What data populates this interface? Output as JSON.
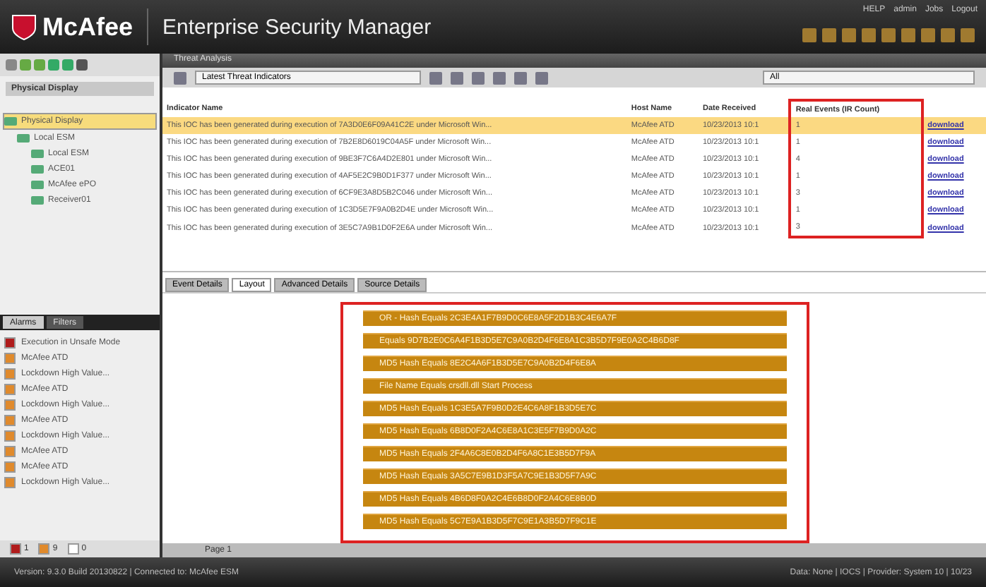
{
  "header": {
    "brand": "McAfee",
    "title": "Enterprise Security Manager",
    "links": [
      "HELP",
      "admin",
      "Jobs",
      "Logout"
    ]
  },
  "sidebar": {
    "view_title": "Physical Display",
    "tree": [
      {
        "label": "Physical Display",
        "selected": true,
        "children": [
          {
            "label": "Local ESM",
            "selected": false,
            "children": [
              {
                "label": "Local ESM",
                "selected": false
              },
              {
                "label": "ACE01",
                "selected": false
              },
              {
                "label": "McAfee ePO",
                "selected": false
              },
              {
                "label": "Receiver01",
                "selected": false
              }
            ]
          }
        ]
      }
    ],
    "tabs": [
      {
        "label": "Alarms",
        "selected": true
      },
      {
        "label": "Filters",
        "selected": false
      }
    ],
    "alarms": [
      {
        "label": "Execution in Unsafe Mode",
        "color": "#b01c1c"
      },
      {
        "label": "McAfee ATD",
        "color": "#e08a2c"
      },
      {
        "label": "Lockdown High Value...",
        "color": "#e08a2c"
      },
      {
        "label": "McAfee ATD",
        "color": "#e08a2c"
      },
      {
        "label": "Lockdown High Value...",
        "color": "#e08a2c"
      },
      {
        "label": "McAfee ATD",
        "color": "#e08a2c"
      },
      {
        "label": "Lockdown High Value...",
        "color": "#e08a2c"
      },
      {
        "label": "McAfee ATD",
        "color": "#e08a2c"
      },
      {
        "label": "McAfee ATD",
        "color": "#e08a2c"
      },
      {
        "label": "Lockdown High Value...",
        "color": "#e08a2c"
      }
    ],
    "severity_counts": [
      {
        "count": "1",
        "color": "#b01c1c"
      },
      {
        "count": "9",
        "color": "#e08a2c"
      },
      {
        "count": "0",
        "color": "#ffffff"
      }
    ]
  },
  "main": {
    "panel_title": "Threat Analysis",
    "view_select": "Latest Threat Indicators",
    "filter_select": "All",
    "table": {
      "columns": [
        "Indicator Name",
        "Host Name",
        "Date Received",
        "Real Events (IR Count)",
        ""
      ],
      "rows": [
        {
          "name": "This IOC has been generated during execution of 7A3D0E6F09A41C2E under Microsoft Win...",
          "host": "McAfee ATD",
          "date": "10/23/2013 10:1",
          "count": "1",
          "action": "download",
          "selected": true
        },
        {
          "name": "This IOC has been generated during execution of 7B2E8D6019C04A5F under Microsoft Win...",
          "host": "McAfee ATD",
          "date": "10/23/2013 10:1",
          "count": "1",
          "action": "download",
          "selected": false
        },
        {
          "name": "This IOC has been generated during execution of 9BE3F7C6A4D2E801 under Microsoft Win...",
          "host": "McAfee ATD",
          "date": "10/23/2013 10:1",
          "count": "4",
          "action": "download",
          "selected": false
        },
        {
          "name": "This IOC has been generated during execution of 4AF5E2C9B0D1F377 under Microsoft Win...",
          "host": "McAfee ATD",
          "date": "10/23/2013 10:1",
          "count": "1",
          "action": "download",
          "selected": false
        },
        {
          "name": "This IOC has been generated during execution of 6CF9E3A8D5B2C046 under Microsoft Win...",
          "host": "McAfee ATD",
          "date": "10/23/2013 10:1",
          "count": "3",
          "action": "download",
          "selected": false
        },
        {
          "name": "This IOC has been generated during execution of 1C3D5E7F9A0B2D4E under Microsoft Win...",
          "host": "McAfee ATD",
          "date": "10/23/2013 10:1",
          "count": "1",
          "action": "download",
          "selected": false
        },
        {
          "name": "This IOC has been generated during execution of 3E5C7A9B1D0F2E6A under Microsoft Win...",
          "host": "McAfee ATD",
          "date": "10/23/2013 10:1",
          "count": "3",
          "action": "download",
          "selected": false
        }
      ]
    },
    "detail_tabs": [
      {
        "label": "Event Details",
        "selected": false
      },
      {
        "label": "Layout",
        "selected": true
      },
      {
        "label": "Advanced Details",
        "selected": false
      },
      {
        "label": "Source Details",
        "selected": false
      }
    ],
    "indicators": [
      "OR - Hash Equals 2C3E4A1F7B9D0C6E8A5F2D1B3C4E6A7F",
      "Equals 9D7B2E0C6A4F1B3D5E7C9A0B2D4F6E8A1C3B5D7F9E0A2C4B6D8F",
      "MD5 Hash Equals 8E2C4A6F1B3D5E7C9A0B2D4F6E8A",
      "File Name Equals crsdll.dll  Start Process",
      "MD5 Hash Equals 1C3E5A7F9B0D2E4C6A8F1B3D5E7C",
      "MD5 Hash Equals 6B8D0F2A4C6E8A1C3E5F7B9D0A2C",
      "MD5 Hash Equals 2F4A6C8E0B2D4F6A8C1E3B5D7F9A",
      "MD5 Hash Equals 3A5C7E9B1D3F5A7C9E1B3D5F7A9C",
      "MD5 Hash Equals 4B6D8F0A2C4E6B8D0F2A4C6E8B0D",
      "MD5 Hash Equals 5C7E9A1B3D5F7C9E1A3B5D7F9C1E"
    ],
    "pager": "Page 1"
  },
  "status_bar": {
    "left": "Version: 9.3.0 Build 20130822 | Connected to: McAfee ESM",
    "right": "Data: None | IOCS | Provider: System 10 | 10/23"
  }
}
